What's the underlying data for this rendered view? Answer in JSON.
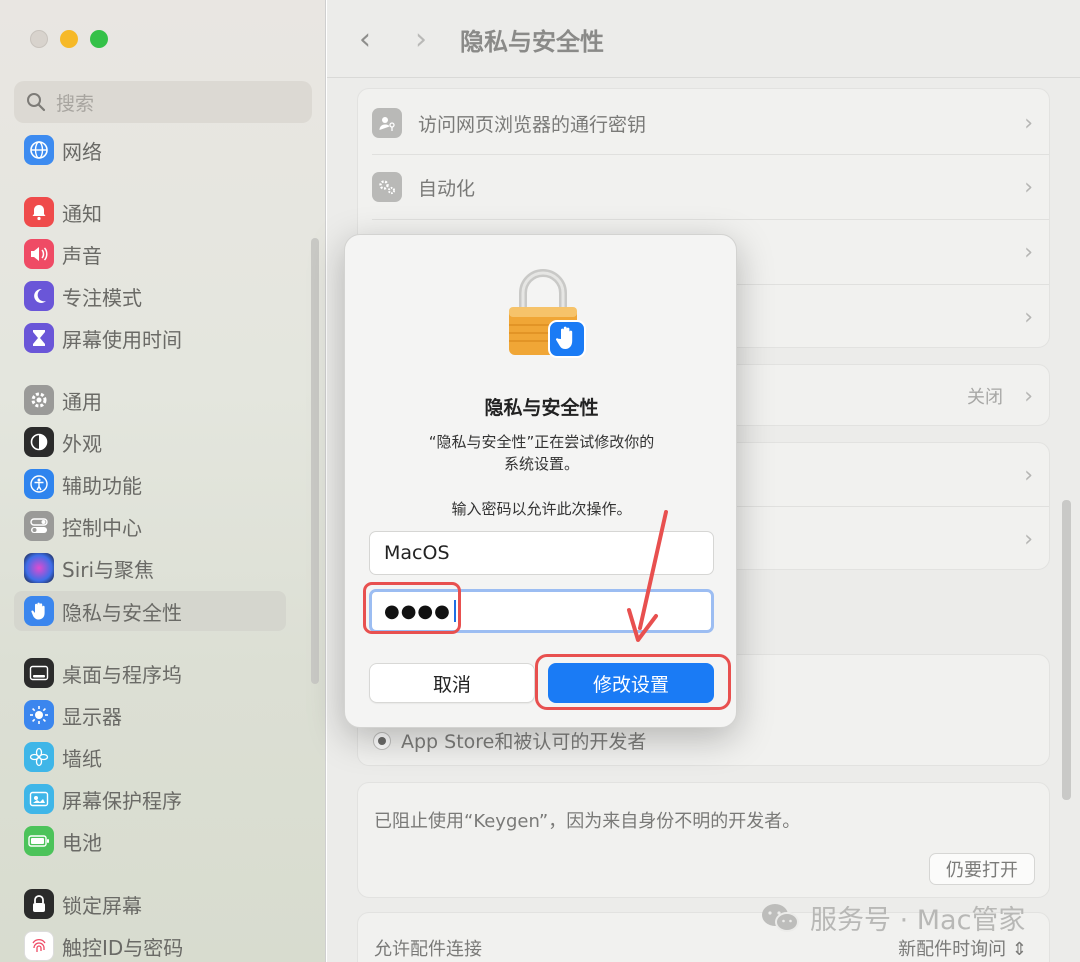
{
  "window": {
    "title": "隐私与安全性"
  },
  "sidebar": {
    "search_placeholder": "搜索",
    "items": [
      {
        "label": "网络",
        "icon": "globe-icon",
        "color": "#3d8bf0"
      },
      {
        "label": "通知",
        "icon": "bell-icon",
        "color": "#ef4b4b"
      },
      {
        "label": "声音",
        "icon": "speaker-icon",
        "color": "#ef4b65"
      },
      {
        "label": "专注模式",
        "icon": "moon-icon",
        "color": "#6a56d8"
      },
      {
        "label": "屏幕使用时间",
        "icon": "hourglass-icon",
        "color": "#6a56d8"
      },
      {
        "label": "通用",
        "icon": "gear-icon",
        "color": "#9a9a98"
      },
      {
        "label": "外观",
        "icon": "appearance-icon",
        "color": "#2b2b2b"
      },
      {
        "label": "辅助功能",
        "icon": "accessibility-icon",
        "color": "#2f84ee"
      },
      {
        "label": "控制中心",
        "icon": "control-center-icon",
        "color": "#9a9a98"
      },
      {
        "label": "Siri与聚焦",
        "icon": "siri-icon",
        "color": "#7a52c9"
      },
      {
        "label": "隐私与安全性",
        "icon": "hand-icon",
        "color": "#3b86ee"
      },
      {
        "label": "桌面与程序坞",
        "icon": "dock-icon",
        "color": "#2b2b2b"
      },
      {
        "label": "显示器",
        "icon": "sun-icon",
        "color": "#3b86ee"
      },
      {
        "label": "墙纸",
        "icon": "flower-icon",
        "color": "#3fb6e8"
      },
      {
        "label": "屏幕保护程序",
        "icon": "screensaver-icon",
        "color": "#3fb6e8"
      },
      {
        "label": "电池",
        "icon": "battery-icon",
        "color": "#4cc35a"
      },
      {
        "label": "锁定屏幕",
        "icon": "lock-screen-icon",
        "color": "#2b2b2b"
      },
      {
        "label": "触控ID与密码",
        "icon": "fingerprint-icon",
        "color": "#ef4b65"
      }
    ]
  },
  "main": {
    "rows": [
      {
        "label": "访问网页浏览器的通行密钥",
        "icon": "person-key-icon"
      },
      {
        "label": "自动化",
        "icon": "gears-icon"
      }
    ],
    "row_value_off": "关闭",
    "radio_label": "App Store和被认可的开发者",
    "blocked_message": "已阻止使用“Keygen”，因为来自身份不明的开发者。",
    "open_anyway": "仍要打开",
    "accessory_label": "允许配件连接",
    "accessory_value": "新配件时询问",
    "watermark": "服务号 · Mac管家"
  },
  "dialog": {
    "title": "隐私与安全性",
    "message_line1": "“隐私与安全性”正在尝试修改你的",
    "message_line2": "系统设置。",
    "prompt": "输入密码以允许此次操作。",
    "username": "MacOS",
    "password_mask": "●●●●",
    "cancel": "取消",
    "confirm": "修改设置"
  },
  "colors": {
    "accent": "#1a7bf5",
    "annotation": "#e8504f"
  }
}
